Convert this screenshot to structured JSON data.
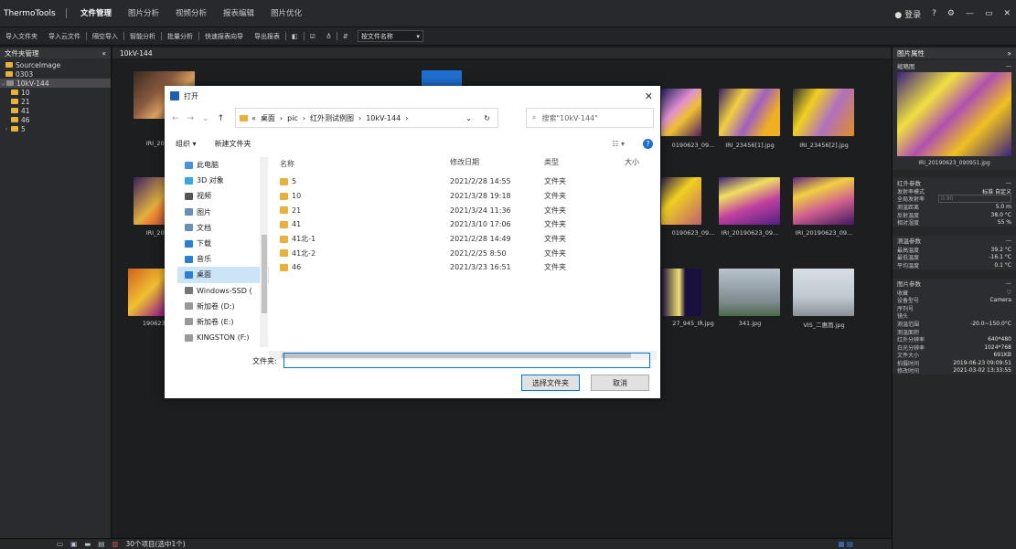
{
  "app": {
    "title": "ThermoTools"
  },
  "menu": {
    "items": [
      "文件管理",
      "图片分析",
      "视频分析",
      "报表编辑",
      "图片优化"
    ]
  },
  "topright": {
    "login": "登录",
    "help": "?",
    "settings": "⚙",
    "min": "—",
    "max": "▭",
    "close": "✕"
  },
  "toolbar": {
    "items": [
      "导入文件夹",
      "导入云文件",
      "隔空导入",
      "智能分析",
      "批量分析",
      "快速报表向导",
      "导出报表"
    ],
    "select_value": "按文件名称"
  },
  "left_panel": {
    "title": "文件夹管理",
    "collapse": "«",
    "tree": [
      {
        "label": "SourceImage",
        "level": 0
      },
      {
        "label": "0303",
        "level": 0
      },
      {
        "label": "10kV-144",
        "level": 0,
        "expanded": true,
        "selected": true
      },
      {
        "label": "10",
        "level": 1
      },
      {
        "label": "21",
        "level": 1
      },
      {
        "label": "41",
        "level": 1
      },
      {
        "label": "46",
        "level": 1
      },
      {
        "label": "5",
        "level": 1,
        "collapsed": true
      }
    ]
  },
  "path": {
    "label": "10kV-144"
  },
  "thumbs": [
    {
      "label": "IRI_2019062"
    },
    {
      "label": "0190623_09..."
    },
    {
      "label": "IRI_23456[1].jpg"
    },
    {
      "label": "IRI_23456[2].jpg"
    },
    {
      "label": "IRI_2019062"
    },
    {
      "label": "0190623_09..."
    },
    {
      "label": "IRI_20190623_09..."
    },
    {
      "label": "IRI_20190623_09..."
    },
    {
      "label": "190623_01"
    },
    {
      "label": "27_945_IR.jpg"
    },
    {
      "label": "341.jpg"
    },
    {
      "label": "VIS_二惠而.jpg"
    }
  ],
  "status": {
    "text": "30个项目(选中1个)"
  },
  "right_panel": {
    "title": "图片属性",
    "thumb_title": "缩略图",
    "thumb_caption": "IRI_20190623_090951.jpg",
    "ir_title": "红外参数",
    "ir_rows": [
      {
        "k": "发射率模式",
        "v": "标准   自定义"
      },
      {
        "k": "全局发射率",
        "v": "0.90"
      },
      {
        "k": "测温距离",
        "v": "5.0 m"
      },
      {
        "k": "反射温度",
        "v": "38.0 °C"
      },
      {
        "k": "相对湿度",
        "v": "55 %"
      }
    ],
    "temp_title": "测温参数",
    "temp_rows": [
      {
        "k": "最高温度",
        "v": "39.2 °C"
      },
      {
        "k": "最低温度",
        "v": "-16.1 °C"
      },
      {
        "k": "平均温度",
        "v": "0.1 °C"
      }
    ],
    "img_title": "图片参数",
    "img_rows": [
      {
        "k": "收藏",
        "v": "♡"
      },
      {
        "k": "设备型号",
        "v": "Camera"
      },
      {
        "k": "序列号",
        "v": ""
      },
      {
        "k": "镜头",
        "v": ""
      },
      {
        "k": "测温范围",
        "v": "-20.0~150.0°C"
      },
      {
        "k": "测温面积",
        "v": ""
      },
      {
        "k": "红外分辨率",
        "v": "640*480"
      },
      {
        "k": "白光分辨率",
        "v": "1024*768"
      },
      {
        "k": "文件大小",
        "v": "691KB"
      },
      {
        "k": "拍摄时间",
        "v": "2019-06-23 09:09:51"
      },
      {
        "k": "修改时间",
        "v": "2021-03-02 13:33:55"
      }
    ]
  },
  "dialog": {
    "title": "打开",
    "close": "✕",
    "breadcrumbs": [
      "«",
      "桌面",
      "›",
      "pic",
      "›",
      "红外测试例图",
      "›",
      "10kV-144",
      "›"
    ],
    "search_placeholder": "搜索\"10kV-144\"",
    "organize": "组织 ▾",
    "new_folder": "新建文件夹",
    "nav_items": [
      {
        "label": "此电脑",
        "color": "#4a90e2"
      },
      {
        "label": "3D 对象",
        "color": "#3aa6dd"
      },
      {
        "label": "视频",
        "color": "#555"
      },
      {
        "label": "图片",
        "color": "#6a8fb8"
      },
      {
        "label": "文档",
        "color": "#6a8fb8"
      },
      {
        "label": "下载",
        "color": "#2a7fd4"
      },
      {
        "label": "音乐",
        "color": "#2a7fd4"
      },
      {
        "label": "桌面",
        "color": "#2a7fd4",
        "selected": true
      },
      {
        "label": "Windows-SSD (",
        "color": "#777"
      },
      {
        "label": "新加卷 (D:)",
        "color": "#999"
      },
      {
        "label": "新加卷 (E:)",
        "color": "#999"
      },
      {
        "label": "KINGSTON (F:)",
        "color": "#999"
      }
    ],
    "columns": [
      "名称",
      "修改日期",
      "类型",
      "大小"
    ],
    "rows": [
      {
        "name": "5",
        "date": "2021/2/28 14:55",
        "type": "文件夹"
      },
      {
        "name": "10",
        "date": "2021/3/28 19:18",
        "type": "文件夹"
      },
      {
        "name": "21",
        "date": "2021/3/24 11:36",
        "type": "文件夹"
      },
      {
        "name": "41",
        "date": "2021/3/10 17:06",
        "type": "文件夹"
      },
      {
        "name": "41北-1",
        "date": "2021/2/28 14:49",
        "type": "文件夹"
      },
      {
        "name": "41北-2",
        "date": "2021/2/25 8:50",
        "type": "文件夹"
      },
      {
        "name": "46",
        "date": "2021/3/23 16:51",
        "type": "文件夹"
      }
    ],
    "folder_label": "文件夹:",
    "folder_value": "",
    "ok": "选择文件夹",
    "cancel": "取消"
  }
}
